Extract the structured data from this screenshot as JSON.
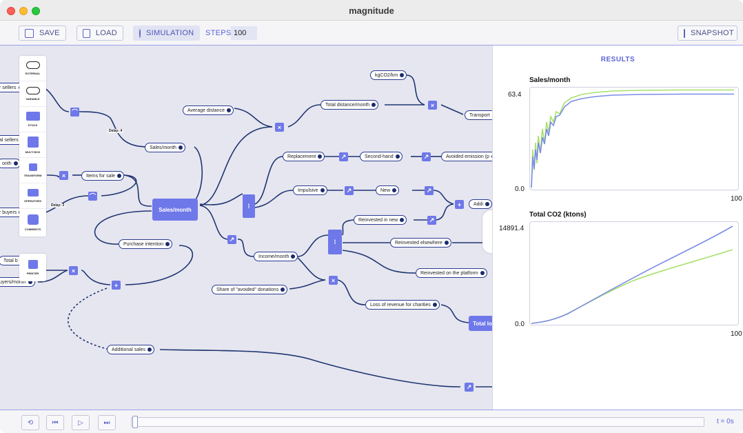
{
  "window": {
    "title": "magnitude"
  },
  "toolbar": {
    "save": "SAVE",
    "load": "LOAD",
    "simulation": "SIMULATION",
    "steps_label": "STEPS",
    "steps_value": "100",
    "snapshot": "SNAPSHOT"
  },
  "palette": {
    "items": [
      "EXTERNAL",
      "VARIABLE",
      "STOCK",
      "MULTI BOX",
      "TRANSFORM",
      "OPERATORS",
      "COMMENTS"
    ],
    "printer": "PRINTER"
  },
  "nodes": {
    "kgco2": "kgCO2/km",
    "avg_distance": "Average distance",
    "total_distance": "Total distance/month",
    "transport": "Transport",
    "sales_month_small": "Sales/month",
    "sales_month_big": "Sales/month",
    "replacement": "Replacement",
    "second_hand": "Second-hand",
    "avoided": "Avoided emission (p",
    "impulsive": "Impulsive",
    "new": "New",
    "addi": "Addi",
    "items_for_sale": "Items for sale",
    "reinvested_new": "Reinvested in new",
    "reinvested_elsewhere": "Reinvested elsewhere",
    "reinvested_platform": "Reinvested on the platform",
    "purchase_intention": "Purchase intention",
    "income_month": "Income/month",
    "share_avoided": "Share of \"avoided\" donations",
    "loss_revenue": "Loss of revenue for charities",
    "total_lo": "Total lo",
    "additional_sales": "Additional sales",
    "left_sellers": "r sellers",
    "left_al_sellers": "al sellers",
    "left_onth": "onth",
    "left_buyers": "r buyers",
    "left_total": "Total b",
    "left_buyers_month": "uyers/month",
    "delay4": "Delay: 4",
    "delay3": "Delay: 3"
  },
  "results": {
    "title": "RESULTS",
    "charts": [
      {
        "title": "Sales/month",
        "ymax": "63.4",
        "ymin": "0.0",
        "xmax": "100"
      },
      {
        "title": "Total CO2 (ktons)",
        "ymax": "14891.4",
        "ymin": "0.0",
        "xmax": "100"
      }
    ]
  },
  "colors": {
    "accent": "#5b63d6",
    "node_fill": "#6f78e8",
    "series_blue": "#7b8ce6",
    "series_green": "#a8e06a"
  },
  "bottom": {
    "time_label": "t = 0s"
  }
}
